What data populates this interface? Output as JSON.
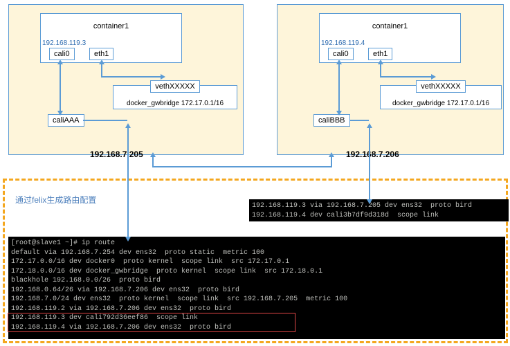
{
  "left_host": {
    "container_label": "container1",
    "container_ip": "192.168.119.3",
    "if_cali0": "cali0",
    "if_eth1": "eth1",
    "if_cali": "caliAAA",
    "veth_label": "vethXXXXX",
    "gwbridge": "docker_gwbridge 172.17.0.1/16",
    "host_ip": "192.168.7.205"
  },
  "right_host": {
    "container_label": "container1",
    "container_ip": "192.168.119.4",
    "if_cali0": "cali0",
    "if_eth1": "eth1",
    "if_cali": "caliBBB",
    "veth_label": "vethXXXXX",
    "gwbridge": "docker_gwbridge 172.17.0.1/16",
    "host_ip": "192.168.7.206"
  },
  "routing_title": "通过felix生成路由配置",
  "terminal_small": {
    "line1": "192.168.119.3 via 192.168.7.205 dev ens32  proto bird",
    "line2": "192.168.119.4 dev cali3b7df9d318d  scope link"
  },
  "terminal_big": {
    "l1": "[root@slave1 ~]# ip route",
    "l2": "default via 192.168.7.254 dev ens32  proto static  metric 100",
    "l3": "172.17.0.0/16 dev docker0  proto kernel  scope link  src 172.17.0.1",
    "l4": "172.18.0.0/16 dev docker_gwbridge  proto kernel  scope link  src 172.18.0.1",
    "l5": "blackhole 192.168.0.0/26  proto bird",
    "l6": "192.168.0.64/26 via 192.168.7.206 dev ens32  proto bird",
    "l7": "192.168.7.0/24 dev ens32  proto kernel  scope link  src 192.168.7.205  metric 100",
    "l8": "192.168.119.2 via 192.168.7.206 dev ens32  proto bird",
    "l9": "192.168.119.3 dev cali792d36eef86  scope link",
    "l10": "192.168.119.4 via 192.168.7.206 dev ens32  proto bird"
  }
}
